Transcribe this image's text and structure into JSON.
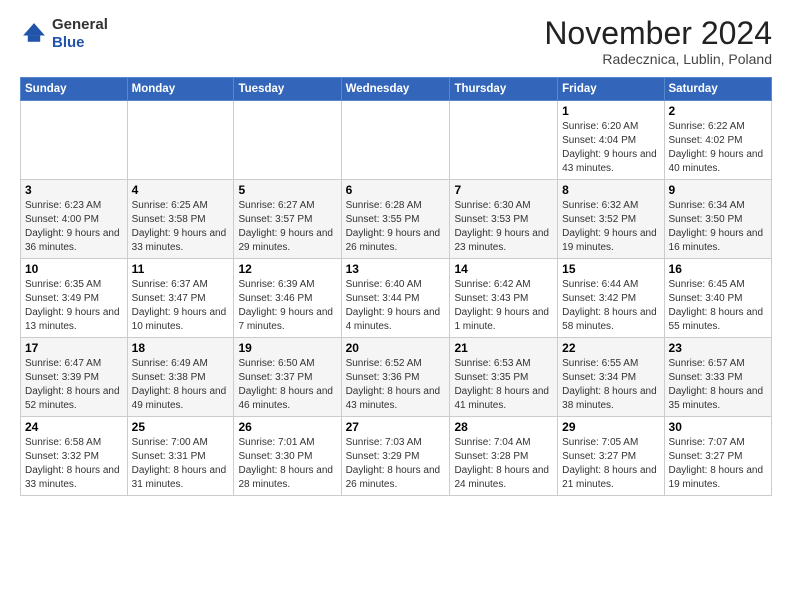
{
  "header": {
    "logo_general": "General",
    "logo_blue": "Blue",
    "month_title": "November 2024",
    "location": "Radecznica, Lublin, Poland"
  },
  "weekdays": [
    "Sunday",
    "Monday",
    "Tuesday",
    "Wednesday",
    "Thursday",
    "Friday",
    "Saturday"
  ],
  "weeks": [
    [
      {
        "day": "",
        "info": ""
      },
      {
        "day": "",
        "info": ""
      },
      {
        "day": "",
        "info": ""
      },
      {
        "day": "",
        "info": ""
      },
      {
        "day": "",
        "info": ""
      },
      {
        "day": "1",
        "info": "Sunrise: 6:20 AM\nSunset: 4:04 PM\nDaylight: 9 hours and 43 minutes."
      },
      {
        "day": "2",
        "info": "Sunrise: 6:22 AM\nSunset: 4:02 PM\nDaylight: 9 hours and 40 minutes."
      }
    ],
    [
      {
        "day": "3",
        "info": "Sunrise: 6:23 AM\nSunset: 4:00 PM\nDaylight: 9 hours and 36 minutes."
      },
      {
        "day": "4",
        "info": "Sunrise: 6:25 AM\nSunset: 3:58 PM\nDaylight: 9 hours and 33 minutes."
      },
      {
        "day": "5",
        "info": "Sunrise: 6:27 AM\nSunset: 3:57 PM\nDaylight: 9 hours and 29 minutes."
      },
      {
        "day": "6",
        "info": "Sunrise: 6:28 AM\nSunset: 3:55 PM\nDaylight: 9 hours and 26 minutes."
      },
      {
        "day": "7",
        "info": "Sunrise: 6:30 AM\nSunset: 3:53 PM\nDaylight: 9 hours and 23 minutes."
      },
      {
        "day": "8",
        "info": "Sunrise: 6:32 AM\nSunset: 3:52 PM\nDaylight: 9 hours and 19 minutes."
      },
      {
        "day": "9",
        "info": "Sunrise: 6:34 AM\nSunset: 3:50 PM\nDaylight: 9 hours and 16 minutes."
      }
    ],
    [
      {
        "day": "10",
        "info": "Sunrise: 6:35 AM\nSunset: 3:49 PM\nDaylight: 9 hours and 13 minutes."
      },
      {
        "day": "11",
        "info": "Sunrise: 6:37 AM\nSunset: 3:47 PM\nDaylight: 9 hours and 10 minutes."
      },
      {
        "day": "12",
        "info": "Sunrise: 6:39 AM\nSunset: 3:46 PM\nDaylight: 9 hours and 7 minutes."
      },
      {
        "day": "13",
        "info": "Sunrise: 6:40 AM\nSunset: 3:44 PM\nDaylight: 9 hours and 4 minutes."
      },
      {
        "day": "14",
        "info": "Sunrise: 6:42 AM\nSunset: 3:43 PM\nDaylight: 9 hours and 1 minute."
      },
      {
        "day": "15",
        "info": "Sunrise: 6:44 AM\nSunset: 3:42 PM\nDaylight: 8 hours and 58 minutes."
      },
      {
        "day": "16",
        "info": "Sunrise: 6:45 AM\nSunset: 3:40 PM\nDaylight: 8 hours and 55 minutes."
      }
    ],
    [
      {
        "day": "17",
        "info": "Sunrise: 6:47 AM\nSunset: 3:39 PM\nDaylight: 8 hours and 52 minutes."
      },
      {
        "day": "18",
        "info": "Sunrise: 6:49 AM\nSunset: 3:38 PM\nDaylight: 8 hours and 49 minutes."
      },
      {
        "day": "19",
        "info": "Sunrise: 6:50 AM\nSunset: 3:37 PM\nDaylight: 8 hours and 46 minutes."
      },
      {
        "day": "20",
        "info": "Sunrise: 6:52 AM\nSunset: 3:36 PM\nDaylight: 8 hours and 43 minutes."
      },
      {
        "day": "21",
        "info": "Sunrise: 6:53 AM\nSunset: 3:35 PM\nDaylight: 8 hours and 41 minutes."
      },
      {
        "day": "22",
        "info": "Sunrise: 6:55 AM\nSunset: 3:34 PM\nDaylight: 8 hours and 38 minutes."
      },
      {
        "day": "23",
        "info": "Sunrise: 6:57 AM\nSunset: 3:33 PM\nDaylight: 8 hours and 35 minutes."
      }
    ],
    [
      {
        "day": "24",
        "info": "Sunrise: 6:58 AM\nSunset: 3:32 PM\nDaylight: 8 hours and 33 minutes."
      },
      {
        "day": "25",
        "info": "Sunrise: 7:00 AM\nSunset: 3:31 PM\nDaylight: 8 hours and 31 minutes."
      },
      {
        "day": "26",
        "info": "Sunrise: 7:01 AM\nSunset: 3:30 PM\nDaylight: 8 hours and 28 minutes."
      },
      {
        "day": "27",
        "info": "Sunrise: 7:03 AM\nSunset: 3:29 PM\nDaylight: 8 hours and 26 minutes."
      },
      {
        "day": "28",
        "info": "Sunrise: 7:04 AM\nSunset: 3:28 PM\nDaylight: 8 hours and 24 minutes."
      },
      {
        "day": "29",
        "info": "Sunrise: 7:05 AM\nSunset: 3:27 PM\nDaylight: 8 hours and 21 minutes."
      },
      {
        "day": "30",
        "info": "Sunrise: 7:07 AM\nSunset: 3:27 PM\nDaylight: 8 hours and 19 minutes."
      }
    ]
  ]
}
